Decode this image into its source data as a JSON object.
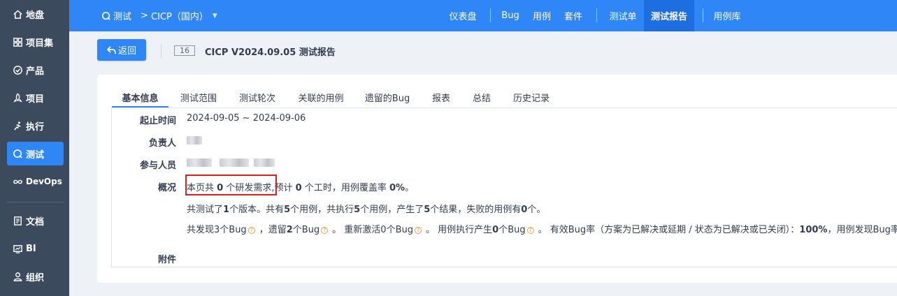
{
  "sidebar": {
    "items": [
      {
        "label": "地盘",
        "icon": "home-icon"
      },
      {
        "label": "项目集",
        "icon": "grid-icon"
      },
      {
        "label": "产品",
        "icon": "product-icon"
      },
      {
        "label": "项目",
        "icon": "project-icon"
      },
      {
        "label": "执行",
        "icon": "run-icon"
      },
      {
        "label": "测试",
        "icon": "test-icon",
        "active": true
      },
      {
        "label": "DevOps",
        "icon": "infinity-icon"
      },
      {
        "label": "文档",
        "icon": "doc-icon"
      },
      {
        "label": "BI",
        "icon": "monitor-icon"
      },
      {
        "label": "组织",
        "icon": "user-icon"
      }
    ]
  },
  "topbar": {
    "module": "测试",
    "separator": ">",
    "product": "CICP（国内）",
    "nav": [
      "仪表盘",
      "Bug",
      "用例",
      "套件",
      "测试单",
      "测试报告",
      "用例库"
    ],
    "active_nav": "测试报告"
  },
  "header": {
    "back_label": "返回",
    "report_id": "16",
    "report_title": "CICP V2024.09.05 测试报告"
  },
  "tabs": [
    "基本信息",
    "测试范围",
    "测试轮次",
    "关联的用例",
    "遗留的Bug",
    "报表",
    "总结",
    "历史记录"
  ],
  "active_tab": "基本信息",
  "info": {
    "date_label": "起止时间",
    "date_value": "2024-09-05 ~ 2024-09-06",
    "owner_label": "负责人",
    "members_label": "参与人员",
    "overview_label": "概况",
    "overview_line1_a": "本页共",
    "overview_line1_b": "0",
    "overview_line1_c": "个研发需求,",
    "overview_line1_d": "预计",
    "overview_line1_e": "0",
    "overview_line1_f": "个工时，用例覆盖率",
    "overview_line1_g": "0%",
    "overview_line1_h": "。",
    "overview_line2_a": "共测试了",
    "overview_line2_b": "1",
    "overview_line2_c": "个版本。共有",
    "overview_line2_d": "5",
    "overview_line2_e": "个用例，共执行",
    "overview_line2_f": "5",
    "overview_line2_g": "个用例，产生了",
    "overview_line2_h": "5",
    "overview_line2_i": "个结果，失败的用例有",
    "overview_line2_j": "0",
    "overview_line2_k": "个。",
    "overview_line3_a": "共发现3个Bug",
    "overview_line3_b": "，遗留",
    "overview_line3_c": "2",
    "overview_line3_d": "个Bug",
    "overview_line3_e": "。 重新激活0个Bug",
    "overview_line3_f": "。 用例执行产生",
    "overview_line3_g": "0",
    "overview_line3_h": "个Bug",
    "overview_line3_i": "。 有效Bug率（方案为已解决或延期 / 状态为已解决或已关闭）：",
    "overview_line3_j": "100%",
    "overview_line3_k": "，用例发现Bug率（用例",
    "attachment_label": "附件"
  },
  "colors": {
    "primary": "#2f86f6",
    "sidebar": "#3c4a5e",
    "highlight": "#e01e1e"
  }
}
